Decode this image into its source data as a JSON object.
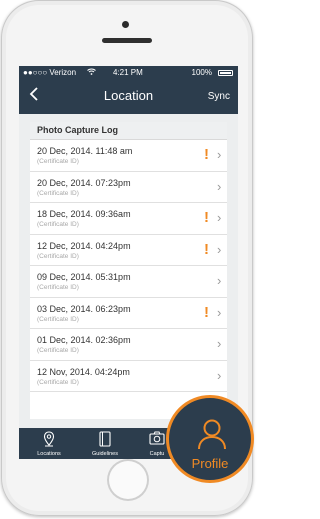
{
  "status_bar": {
    "carrier": "●●○○○ Verizon",
    "time": "4:21 PM",
    "battery": "100%"
  },
  "nav": {
    "back_icon": "chevron-left-icon",
    "title": "Location",
    "sync_label": "Sync"
  },
  "log": {
    "header": "Photo Capture Log",
    "rows": [
      {
        "date": "20 Dec, 2014. 11:48 am",
        "cert": "(Certificate ID)",
        "warning": "!"
      },
      {
        "date": "20 Dec, 2014. 07:23pm",
        "cert": "(Certificate ID)",
        "warning": ""
      },
      {
        "date": "18 Dec, 2014. 09:36am",
        "cert": "(Certificate ID)",
        "warning": "!"
      },
      {
        "date": "12 Dec, 2014. 04:24pm",
        "cert": "(Certificate ID)",
        "warning": "!"
      },
      {
        "date": "09 Dec, 2014. 05:31pm",
        "cert": "(Certificate ID)",
        "warning": ""
      },
      {
        "date": "03 Dec, 2014. 06:23pm",
        "cert": "(Certificate ID)",
        "warning": "!"
      },
      {
        "date": "01 Dec, 2014. 02:36pm",
        "cert": "(Certificate ID)",
        "warning": ""
      },
      {
        "date": "12 Nov, 2014. 04:24pm",
        "cert": "(Certificate ID)",
        "warning": ""
      }
    ]
  },
  "tabs": [
    {
      "label": "Locations",
      "icon": "map-pin-icon"
    },
    {
      "label": "Guidelines",
      "icon": "document-icon"
    },
    {
      "label": "Captu",
      "icon": "camera-icon"
    }
  ],
  "profile": {
    "label": "Profile",
    "icon": "user-icon"
  },
  "colors": {
    "nav_bg": "#2c3d4d",
    "accent": "#f08a24",
    "list_bg": "#eceeef"
  }
}
